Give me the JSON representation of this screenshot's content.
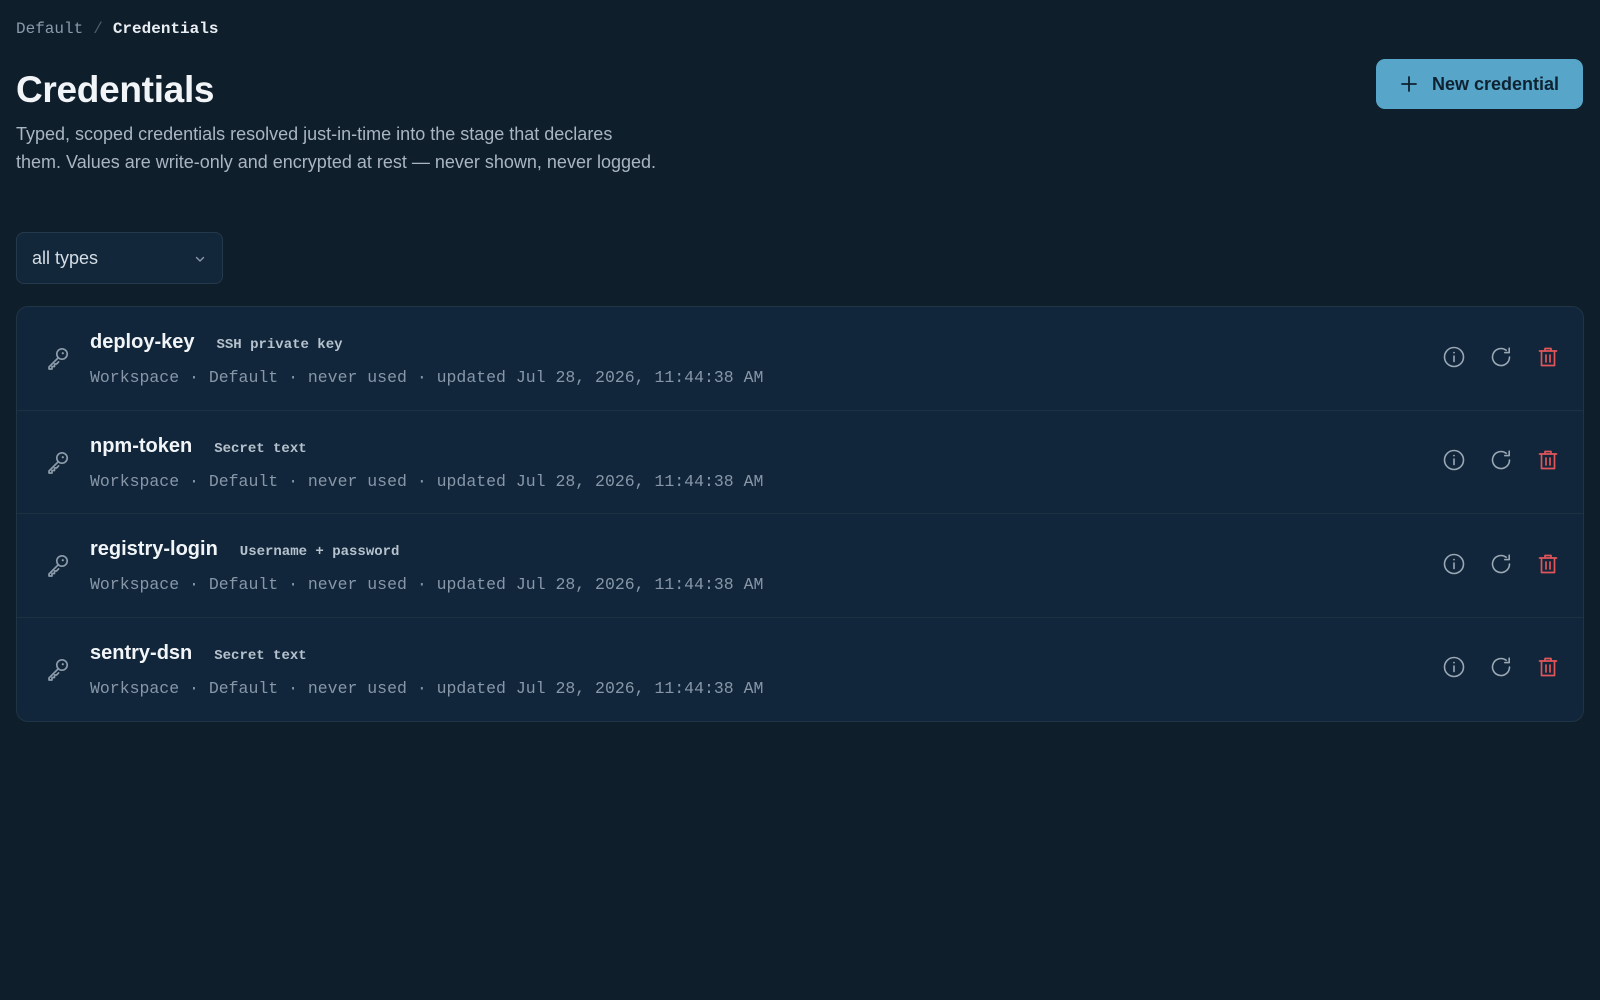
{
  "breadcrumb": {
    "parent": "Default",
    "separator": "/",
    "current": "Credentials"
  },
  "header": {
    "title": "Credentials",
    "description": "Typed, scoped credentials resolved just-in-time into the stage that declares them. Values are write-only and encrypted at rest — never shown, never logged.",
    "new_button_label": "New credential"
  },
  "filter": {
    "selected": "all types"
  },
  "credentials": [
    {
      "name": "deploy-key",
      "type": "SSH private key",
      "scope": "Workspace",
      "workspace": "Default",
      "usage": "never used",
      "updated": "updated Jul 28, 2026, 11:44:38 AM"
    },
    {
      "name": "npm-token",
      "type": "Secret text",
      "scope": "Workspace",
      "workspace": "Default",
      "usage": "never used",
      "updated": "updated Jul 28, 2026, 11:44:38 AM"
    },
    {
      "name": "registry-login",
      "type": "Username + password",
      "scope": "Workspace",
      "workspace": "Default",
      "usage": "never used",
      "updated": "updated Jul 28, 2026, 11:44:38 AM"
    },
    {
      "name": "sentry-dsn",
      "type": "Secret text",
      "scope": "Workspace",
      "workspace": "Default",
      "usage": "never used",
      "updated": "updated Jul 28, 2026, 11:44:38 AM"
    }
  ],
  "meta_separator": "·",
  "icons": {
    "row": "key-icon",
    "info": "info-icon",
    "rotate": "refresh-icon",
    "delete": "trash-icon",
    "add": "plus-icon",
    "dropdown": "chevron-down-icon"
  },
  "colors": {
    "background": "#0f1e2b",
    "accent": "#57a5c8",
    "danger": "#e0555a"
  }
}
